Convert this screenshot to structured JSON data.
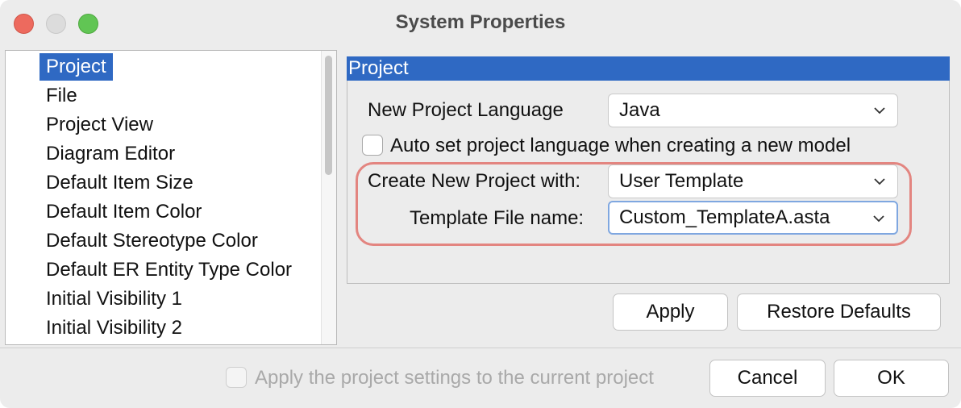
{
  "window": {
    "title": "System Properties"
  },
  "tree": {
    "items": [
      {
        "label": "Project",
        "selected": true
      },
      {
        "label": "File"
      },
      {
        "label": "Project View"
      },
      {
        "label": "Diagram Editor"
      },
      {
        "label": "Default Item Size"
      },
      {
        "label": "Default Item Color"
      },
      {
        "label": "Default Stereotype Color"
      },
      {
        "label": "Default ER Entity Type Color"
      },
      {
        "label": "Initial Visibility 1"
      },
      {
        "label": "Initial Visibility 2"
      }
    ]
  },
  "panel": {
    "header": "Project",
    "new_project_language_label": "New Project Language",
    "new_project_language_value": "Java",
    "auto_set_label": "Auto set project language when creating a new model",
    "create_with_label": "Create New Project with:",
    "create_with_value": "User Template",
    "template_file_label": "Template File name:",
    "template_file_value": "Custom_TemplateA.asta",
    "apply_label": "Apply",
    "restore_label": "Restore Defaults"
  },
  "footer": {
    "apply_current_label": "Apply the project settings to the current project",
    "cancel_label": "Cancel",
    "ok_label": "OK"
  },
  "colors": {
    "selection": "#2f69c3",
    "highlight_outline": "#e38580"
  },
  "icons": [
    "close-window-icon",
    "minimize-window-icon",
    "maximize-window-icon",
    "chevron-down-icon"
  ]
}
